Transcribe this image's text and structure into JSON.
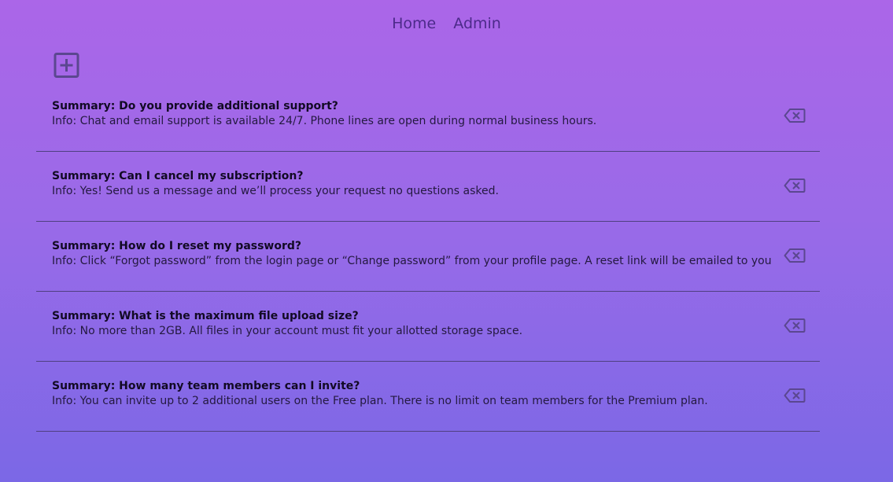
{
  "nav": {
    "home_label": "Home",
    "admin_label": "Admin"
  },
  "icons": {
    "add": "plus-square-icon",
    "delete": "backspace-icon",
    "icon_color": "#5b4790"
  },
  "faqs": [
    {
      "summary": "Summary: Do you provide additional support?",
      "info": "Info: Chat and email support is available 24/7. Phone lines are open during normal business hours."
    },
    {
      "summary": "Summary: Can I cancel my subscription?",
      "info": "Info: Yes! Send us a message and we’ll process your request no questions asked."
    },
    {
      "summary": "Summary: How do I reset my password?",
      "info": "Info: Click “Forgot password” from the login page or “Change password” from your profile page. A reset link will be emailed to you"
    },
    {
      "summary": "Summary: What is the maximum file upload size?",
      "info": "Info: No more than 2GB. All files in your account must fit your allotted storage space."
    },
    {
      "summary": "Summary: How many team members can I invite?",
      "info": "Info: You can invite up to 2 additional users on the Free plan. There is no limit on team members for the Premium plan."
    }
  ]
}
